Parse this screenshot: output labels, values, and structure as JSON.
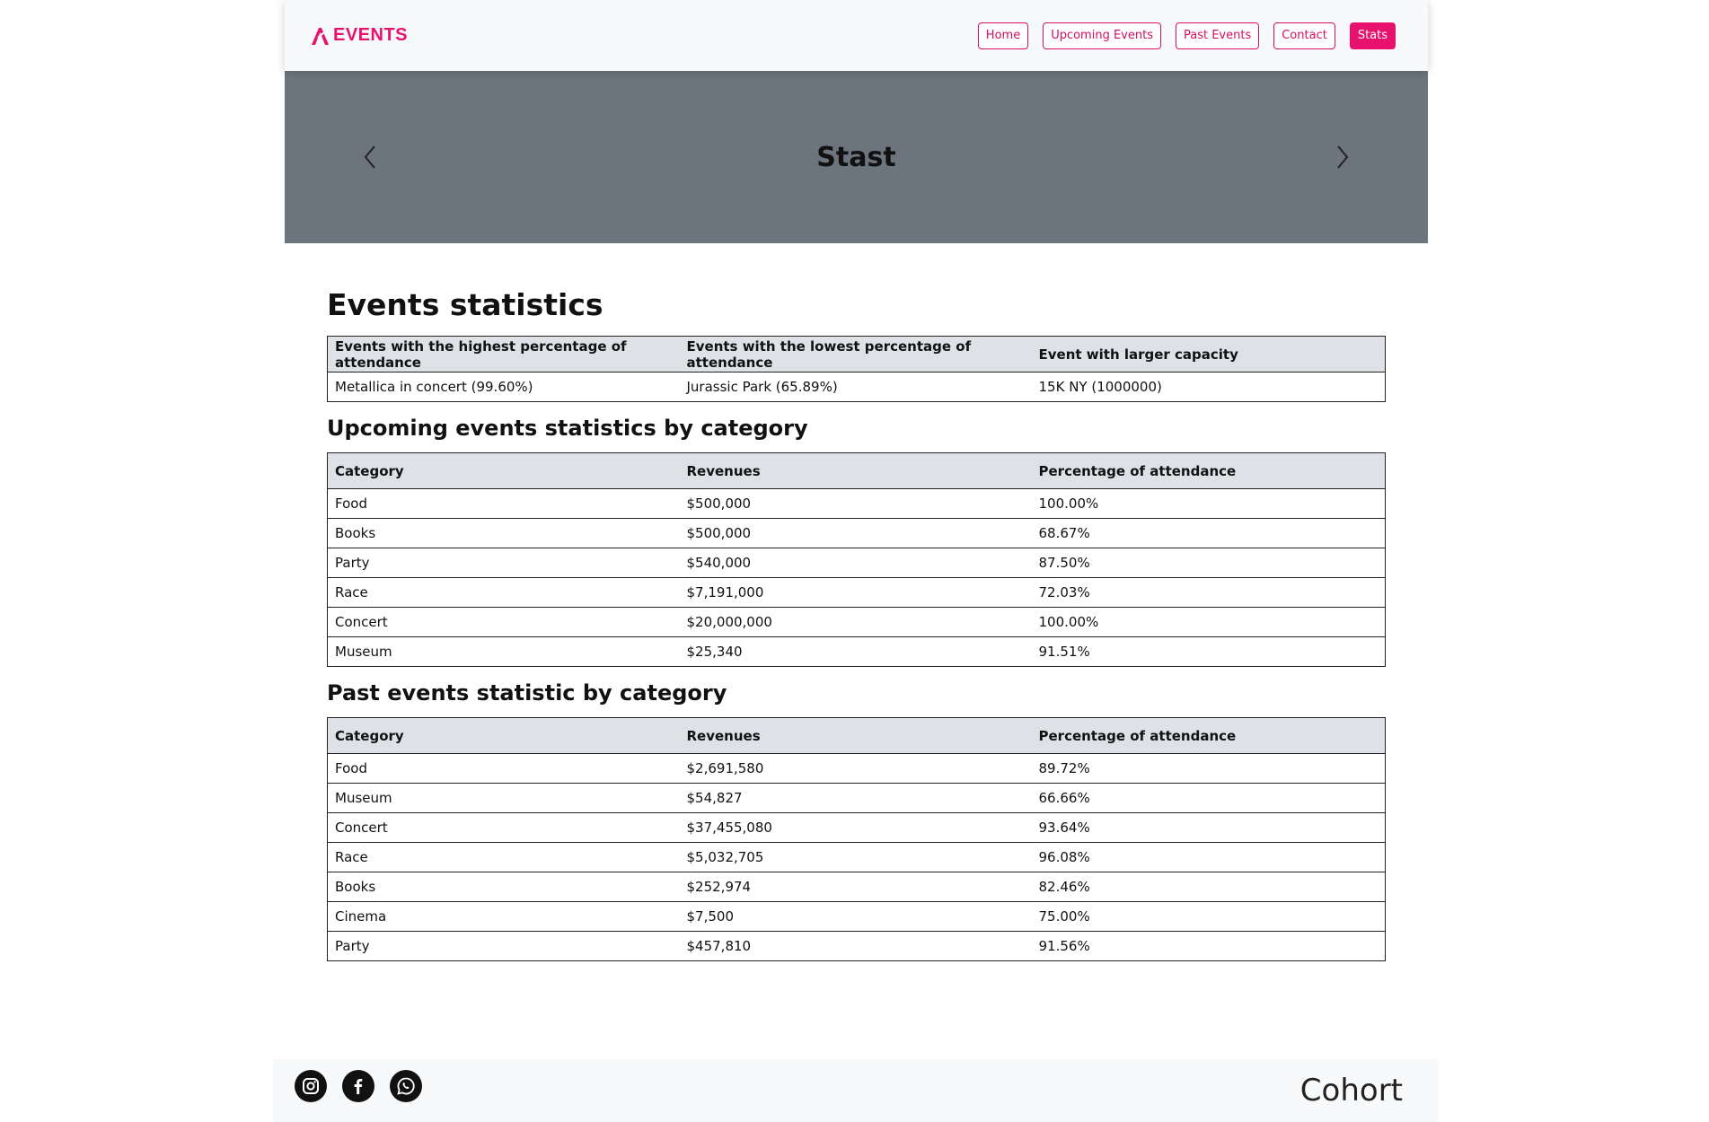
{
  "brand": {
    "logo_text": "EVENTS",
    "accent": "#e8116e"
  },
  "nav": {
    "items": [
      {
        "label": "Home"
      },
      {
        "label": "Upcoming Events"
      },
      {
        "label": "Past Events"
      },
      {
        "label": "Contact"
      },
      {
        "label": "Stats",
        "active": true
      }
    ]
  },
  "hero": {
    "title": "Stast",
    "prev_icon": "chevron-left-icon",
    "next_icon": "chevron-right-icon"
  },
  "events_stats": {
    "title": "Events statistics",
    "headers": [
      "Events with the highest percentage of attendance",
      "Events with the lowest percentage of attendance",
      "Event with larger capacity"
    ],
    "row": [
      "Metallica in concert (99.60%)",
      "Jurassic Park (65.89%)",
      "15K NY (1000000)"
    ]
  },
  "upcoming": {
    "title": "Upcoming events statistics by category",
    "headers": [
      "Category",
      "Revenues",
      "Percentage of attendance"
    ],
    "rows": [
      [
        "Food",
        "$500,000",
        "100.00%"
      ],
      [
        "Books",
        "$500,000",
        "68.67%"
      ],
      [
        "Party",
        "$540,000",
        "87.50%"
      ],
      [
        "Race",
        "$7,191,000",
        "72.03%"
      ],
      [
        "Concert",
        "$20,000,000",
        "100.00%"
      ],
      [
        "Museum",
        "$25,340",
        "91.51%"
      ]
    ]
  },
  "past": {
    "title": "Past events statistic by category",
    "headers": [
      "Category",
      "Revenues",
      "Percentage of attendance"
    ],
    "rows": [
      [
        "Food",
        "$2,691,580",
        "89.72%"
      ],
      [
        "Museum",
        "$54,827",
        "66.66%"
      ],
      [
        "Concert",
        "$37,455,080",
        "93.64%"
      ],
      [
        "Race",
        "$5,032,705",
        "96.08%"
      ],
      [
        "Books",
        "$252,974",
        "82.46%"
      ],
      [
        "Cinema",
        "$7,500",
        "75.00%"
      ],
      [
        "Party",
        "$457,810",
        "91.56%"
      ]
    ]
  },
  "footer": {
    "socials": [
      "instagram-icon",
      "facebook-icon",
      "whatsapp-icon"
    ],
    "text": "Cohort"
  }
}
